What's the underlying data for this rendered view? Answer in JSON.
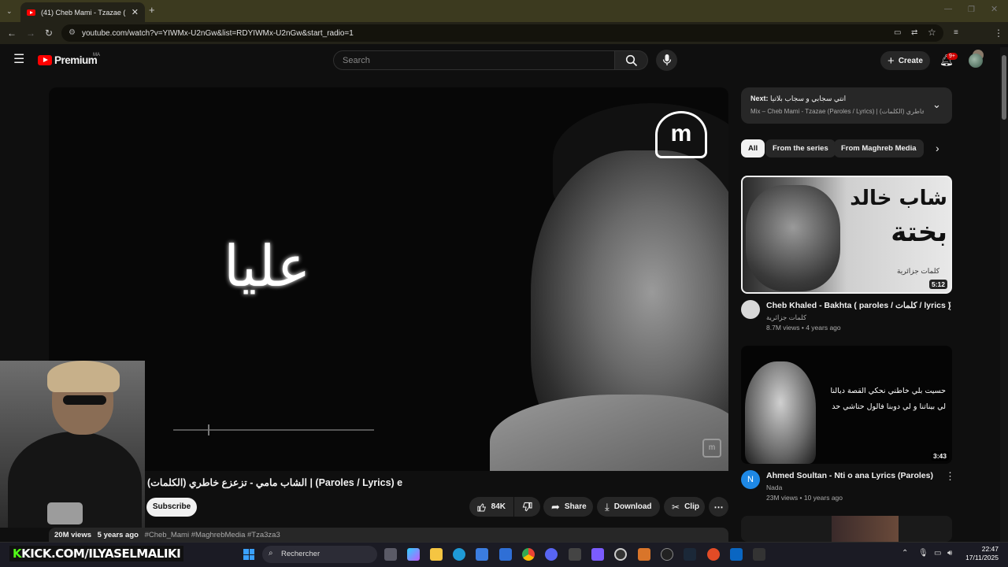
{
  "browser": {
    "tab_title": "(41) Cheb Mami - Tzazae (Parol",
    "url": "youtube.com/watch?v=YIWMx-U2nGw&list=RDYIWMx-U2nGw&start_radio=1"
  },
  "youtube": {
    "logo_text": "Premium",
    "country_code": "MA",
    "search_placeholder": "Search",
    "create_label": "Create",
    "notification_count": "9+"
  },
  "player": {
    "overlay_text": "عليا",
    "channel_logo_text": "m"
  },
  "video": {
    "title": "الشاب مامي - تزعزع خاطري (الكلمات) | (Paroles / Lyrics) e",
    "subscribe_label": "Subscribe",
    "like_count": "84K",
    "share_label": "Share",
    "download_label": "Download",
    "clip_label": "Clip",
    "views": "20M views",
    "age": "5 years ago",
    "hashtags": "#Cheb_Mami #MaghrebMedia #Tza3za3"
  },
  "next": {
    "prefix": "Next:",
    "next_title": "انتي سجابي و سجاب بلاتيا",
    "mix_title": "Mix – Cheb Mami - Tzazae (Paroles / Lyrics) | (الكلمات) خاطري ..."
  },
  "chips": [
    "All",
    "From the series",
    "From Maghreb Media"
  ],
  "recommendations": [
    {
      "thumb_text_line1": "شاب خالد",
      "thumb_text_line2": "بختة",
      "thumb_caption": "كلمات جزائرية",
      "duration": "5:12",
      "title": "Cheb Khaled - Bakhta ( paroles / كلمات / lyrics )",
      "channel": "كلمات جزائرية",
      "meta": "8.7M views • 4 years ago",
      "avatar_color": "#d9d9d9"
    },
    {
      "thumb_text_line1": "حسيت بلي خاطني نحكي القصة ديالنا",
      "thumb_text_line2": "لي بيناتنا و لي دوبنا فالول حتاشي حد",
      "duration": "3:43",
      "title": "Ahmed Soultan - Nti o ana Lyrics (Paroles)",
      "channel": "Nada",
      "meta": "23M views • 10 years ago",
      "avatar_letter": "N",
      "avatar_color": "#1e88e5"
    }
  ],
  "stream_overlay": {
    "kick_prefix": "K",
    "kick_text": "KICK.COM/ILYASELMALIKI"
  },
  "taskbar": {
    "search_label": "Rechercher",
    "time": "22:47",
    "date": "17/11/2025"
  }
}
